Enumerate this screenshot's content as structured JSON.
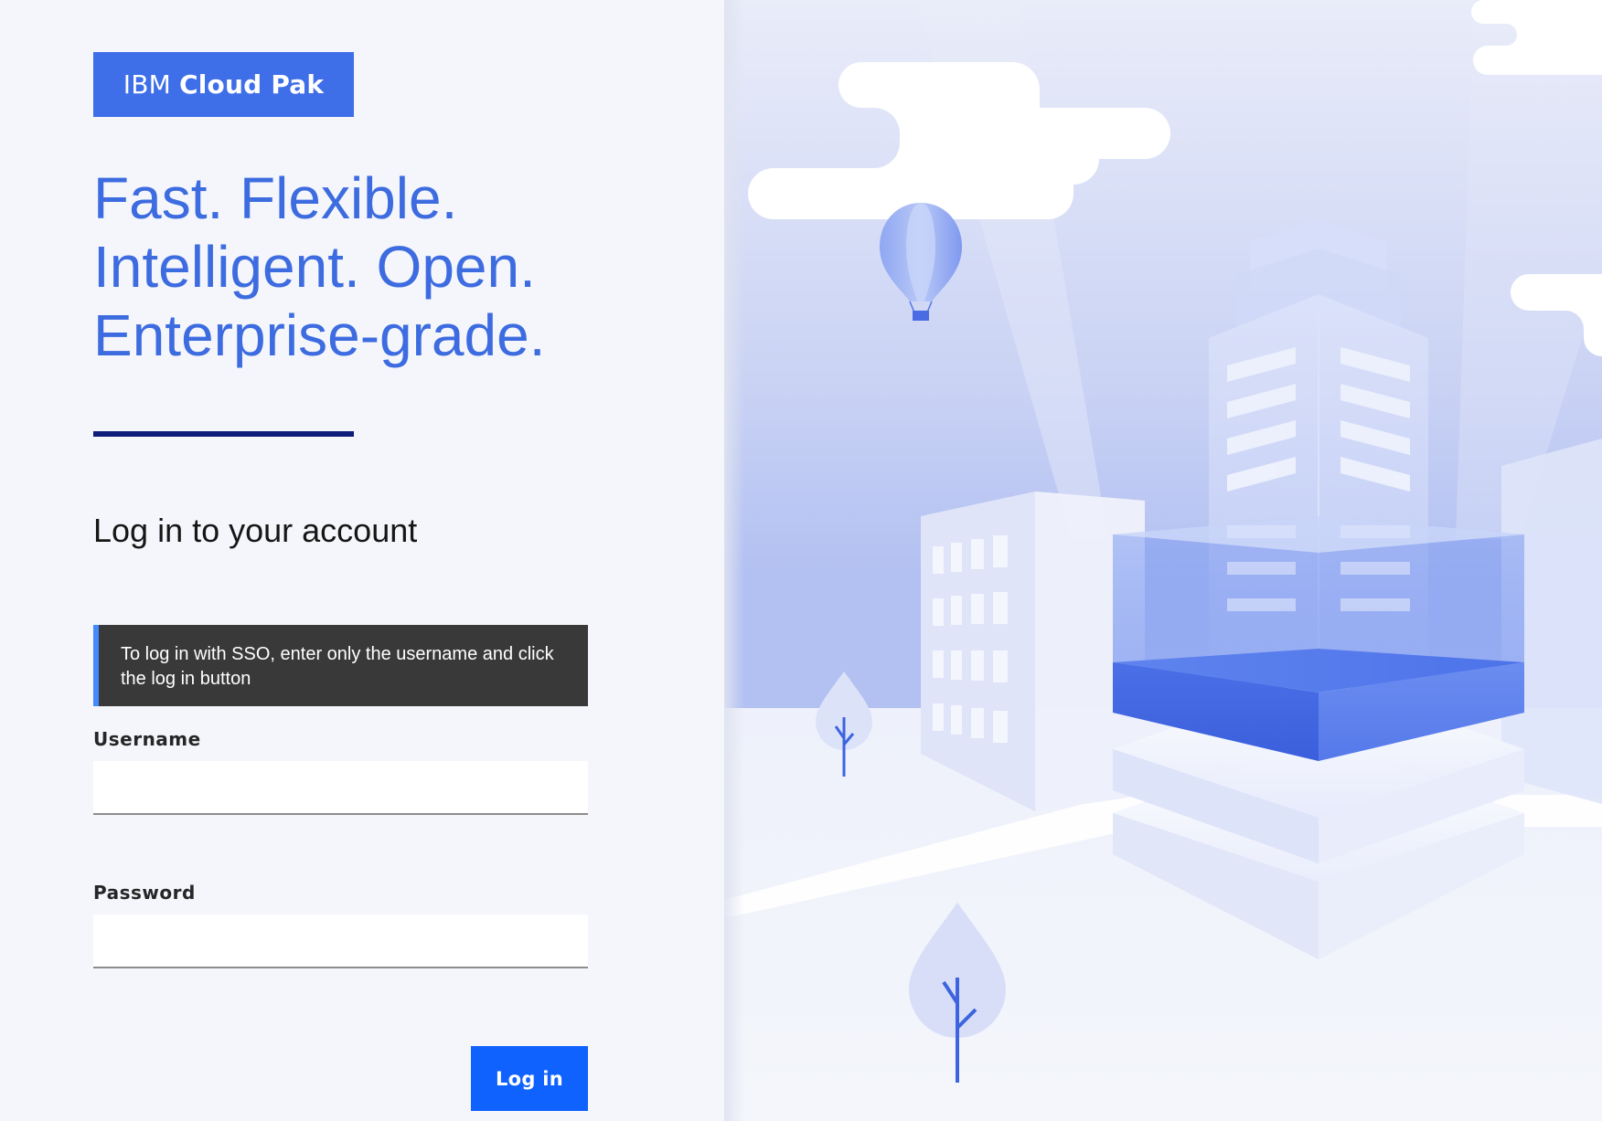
{
  "brand": {
    "prefix": "IBM",
    "name": "Cloud Pak"
  },
  "tagline": {
    "line1": "Fast. Flexible.",
    "line2": "Intelligent. Open.",
    "line3": "Enterprise-grade."
  },
  "login": {
    "heading": "Log in to your account",
    "sso_notice": "To log in with SSO, enter only the username and click the log in button",
    "username": {
      "label": "Username",
      "value": ""
    },
    "password": {
      "label": "Password",
      "value": ""
    },
    "submit_label": "Log in"
  },
  "colors": {
    "brand_blue": "#3e6ee8",
    "primary_button": "#0f62fe",
    "tagline_blue": "#3d6be0",
    "rule": "#0f1d7a",
    "notice_bg": "#393939",
    "notice_accent": "#4589ff"
  },
  "illustration": {
    "elements": [
      "cloud",
      "hot-air-balloon",
      "office-building",
      "tower-building",
      "glowing-platform",
      "tree"
    ]
  }
}
